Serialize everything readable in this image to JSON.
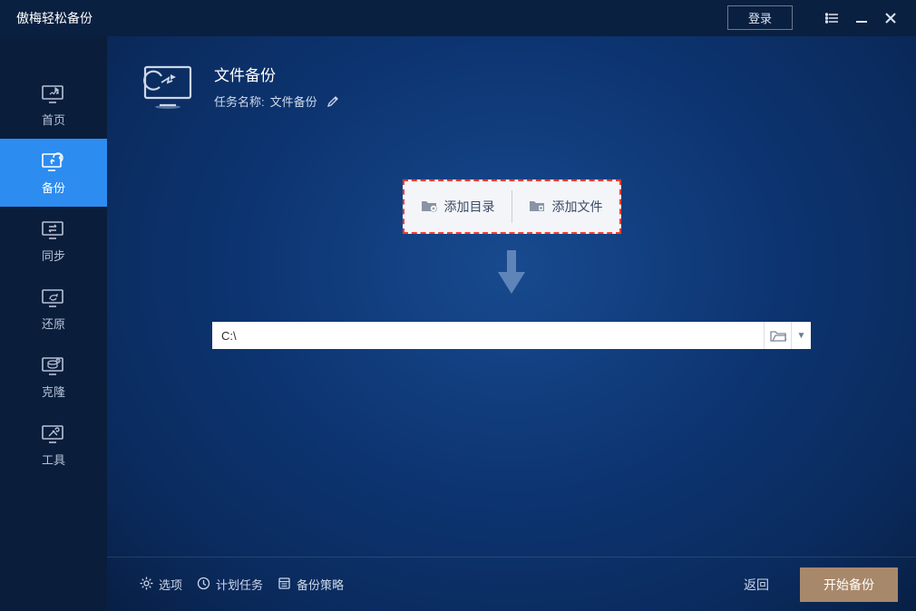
{
  "app_title": "傲梅轻松备份",
  "login_label": "登录",
  "sidebar": {
    "items": [
      {
        "label": "首页"
      },
      {
        "label": "备份"
      },
      {
        "label": "同步"
      },
      {
        "label": "还原"
      },
      {
        "label": "克隆"
      },
      {
        "label": "工具"
      }
    ]
  },
  "page": {
    "title": "文件备份",
    "task_label": "任务名称:",
    "task_name": "文件备份"
  },
  "source": {
    "add_folder": "添加目录",
    "add_file": "添加文件"
  },
  "destination_path": "C:\\",
  "footer": {
    "options": "选项",
    "schedule": "计划任务",
    "strategy": "备份策略",
    "back": "返回",
    "start": "开始备份"
  }
}
